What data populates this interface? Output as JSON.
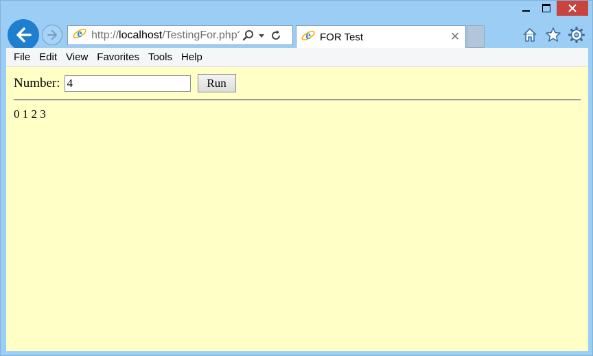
{
  "browser": {
    "url_prefix": "http://",
    "url_host": "localhost",
    "url_path": "/TestingFor.php?:",
    "tab_title": "FOR Test"
  },
  "menu": {
    "items": [
      "File",
      "Edit",
      "View",
      "Favorites",
      "Tools",
      "Help"
    ]
  },
  "form": {
    "label": "Number:",
    "input_value": "4",
    "run_label": "Run"
  },
  "output": {
    "text": "0 1 2 3"
  },
  "colors": {
    "frame": "#9ccdf4",
    "page_background": "#ffffc6",
    "close_button": "#c7443f",
    "back_button": "#1f7fce"
  },
  "icons": {
    "back": "back-arrow-icon",
    "forward": "forward-arrow-icon",
    "site": "ie-logo-icon",
    "search": "search-icon",
    "dropdown": "chevron-down-icon",
    "refresh": "refresh-icon",
    "home": "home-icon",
    "favorites": "star-icon",
    "settings": "gear-icon"
  }
}
